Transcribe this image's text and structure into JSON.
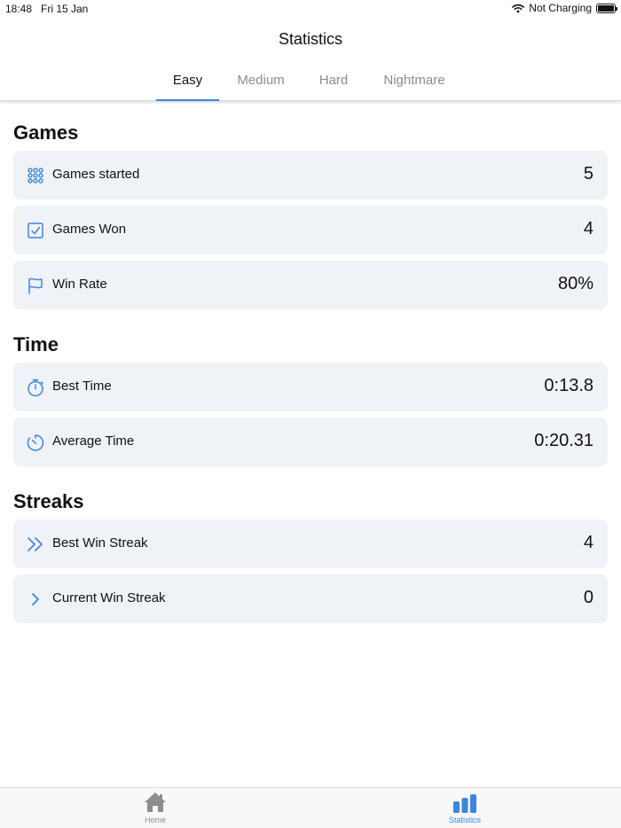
{
  "status_bar": {
    "time": "18:48",
    "date": "Fri 15 Jan",
    "battery_status": "Not Charging"
  },
  "header": {
    "title": "Statistics"
  },
  "tabs": [
    {
      "label": "Easy",
      "active": true
    },
    {
      "label": "Medium",
      "active": false
    },
    {
      "label": "Hard",
      "active": false
    },
    {
      "label": "Nightmare",
      "active": false
    }
  ],
  "sections": {
    "games": {
      "title": "Games",
      "rows": [
        {
          "label": "Games started",
          "value": "5",
          "icon": "grid-dots-icon"
        },
        {
          "label": "Games Won",
          "value": "4",
          "icon": "checkbox-icon"
        },
        {
          "label": "Win Rate",
          "value": "80%",
          "icon": "flag-icon"
        }
      ]
    },
    "time": {
      "title": "Time",
      "rows": [
        {
          "label": "Best Time",
          "value": "0:13.8",
          "icon": "stopwatch-icon"
        },
        {
          "label": "Average Time",
          "value": "0:20.31",
          "icon": "timer-icon"
        }
      ]
    },
    "streaks": {
      "title": "Streaks",
      "rows": [
        {
          "label": "Best Win Streak",
          "value": "4",
          "icon": "double-chevron-right-icon"
        },
        {
          "label": "Current Win Streak",
          "value": "0",
          "icon": "chevron-right-icon"
        }
      ]
    }
  },
  "tab_bar": {
    "items": [
      {
        "label": "Home",
        "icon": "home-icon",
        "active": false
      },
      {
        "label": "Statistics",
        "icon": "bar-chart-icon",
        "active": true
      }
    ]
  },
  "colors": {
    "accent": "#3a86e0",
    "card_bg": "#eff2f7",
    "inactive": "#8c8c91"
  }
}
